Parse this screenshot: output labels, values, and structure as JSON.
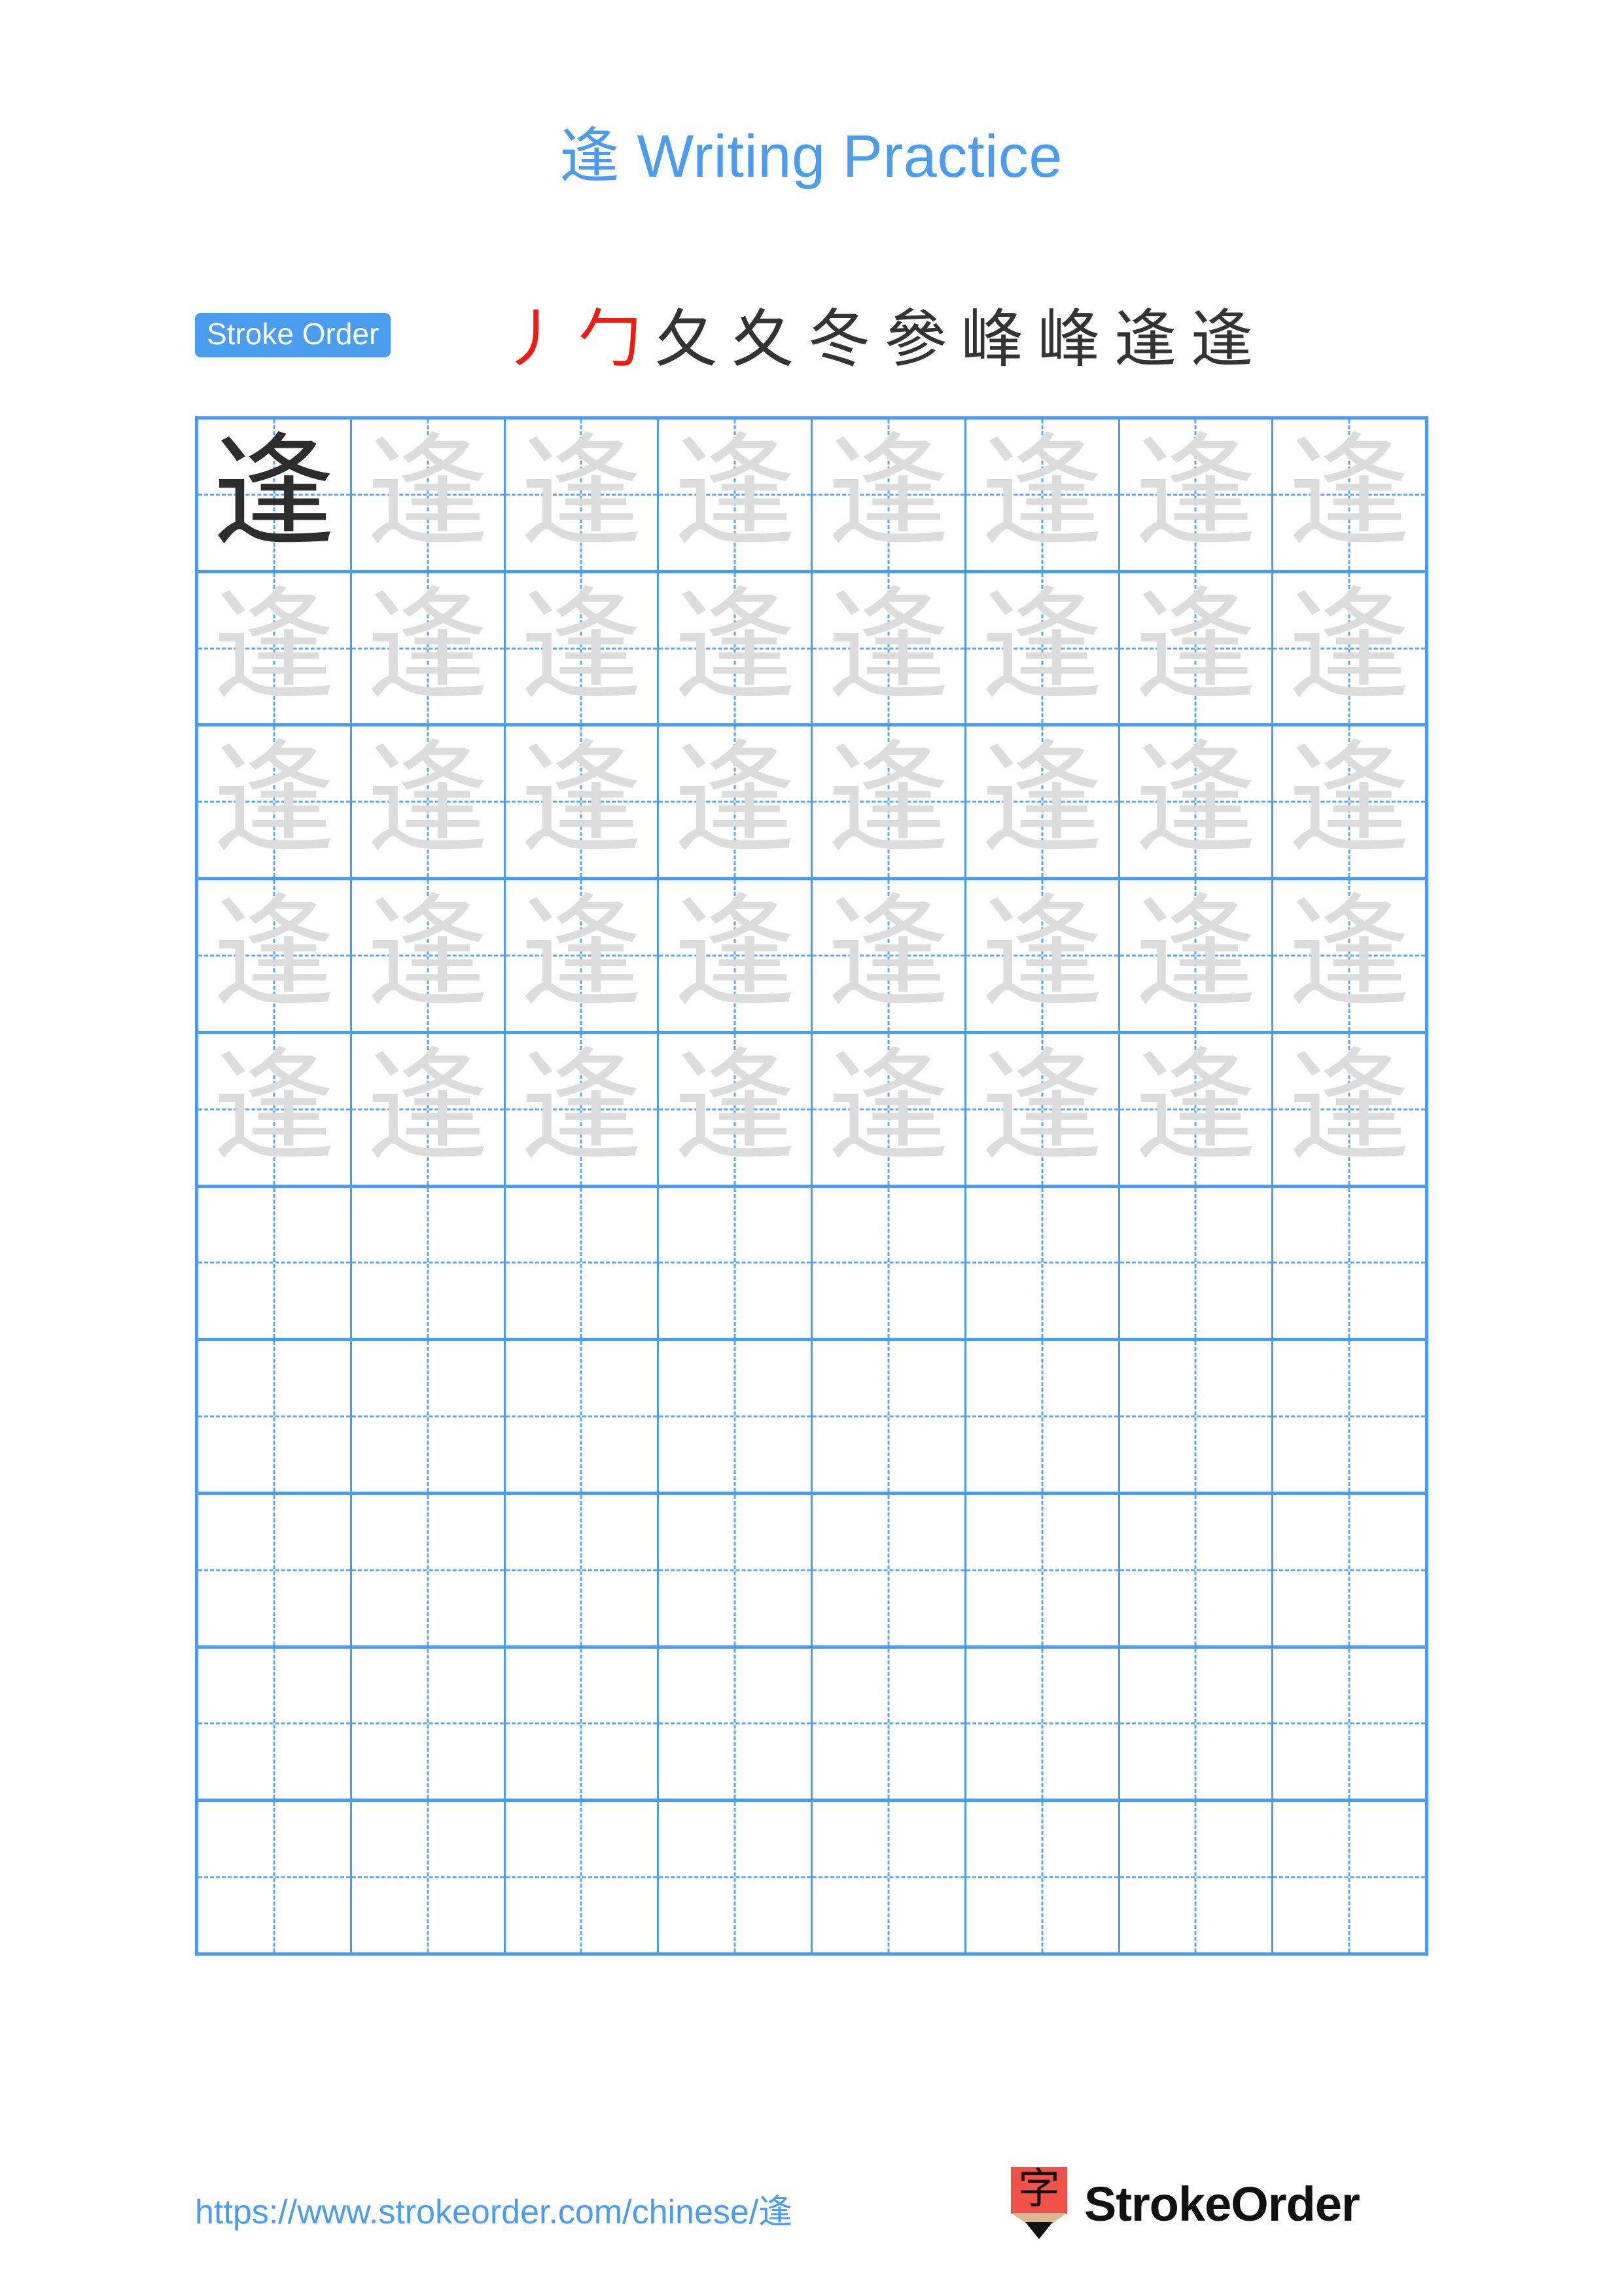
{
  "character": "逢",
  "header": {
    "title": "逢 Writing Practice"
  },
  "stroke_order": {
    "badge_label": "Stroke Order",
    "total_strokes": 10,
    "steps": [
      {
        "index": 1,
        "glyph": "丿",
        "new_stroke_color": "#ee1b11",
        "all_new": true
      },
      {
        "index": 2,
        "glyph": "勹",
        "new_stroke_color": "#ee1b11",
        "all_new": true
      },
      {
        "index": 3,
        "glyph": "夂",
        "new_stroke_color": "#ee1b11",
        "all_new": false
      },
      {
        "index": 4,
        "glyph": "夊",
        "new_stroke_color": "#ee1b11",
        "all_new": false
      },
      {
        "index": 5,
        "glyph": "冬",
        "new_stroke_color": "#ee1b11",
        "all_new": false
      },
      {
        "index": 6,
        "glyph": "參",
        "new_stroke_color": "#ee1b11",
        "all_new": false
      },
      {
        "index": 7,
        "glyph": "峰",
        "new_stroke_color": "#ee1b11",
        "all_new": false
      },
      {
        "index": 8,
        "glyph": "峰",
        "new_stroke_color": "#ee1b11",
        "all_new": false
      },
      {
        "index": 9,
        "glyph": "逢",
        "new_stroke_color": "#ee1b11",
        "all_new": false
      },
      {
        "index": 10,
        "glyph": "逢",
        "new_stroke_color": "#ee1b11",
        "all_new": false
      }
    ]
  },
  "grid": {
    "columns": 8,
    "rows": 10,
    "filled_rows": 5,
    "first_cell_style": "dark",
    "trace_style": "light",
    "border_color": "#4a9cf0",
    "guide_color": "#5aa8f2",
    "dark_char_color": "#2d2d2d",
    "light_char_color": "#dcdcdc",
    "cells": [
      [
        "逢",
        "逢",
        "逢",
        "逢",
        "逢",
        "逢",
        "逢",
        "逢"
      ],
      [
        "逢",
        "逢",
        "逢",
        "逢",
        "逢",
        "逢",
        "逢",
        "逢"
      ],
      [
        "逢",
        "逢",
        "逢",
        "逢",
        "逢",
        "逢",
        "逢",
        "逢"
      ],
      [
        "逢",
        "逢",
        "逢",
        "逢",
        "逢",
        "逢",
        "逢",
        "逢"
      ],
      [
        "逢",
        "逢",
        "逢",
        "逢",
        "逢",
        "逢",
        "逢",
        "逢"
      ],
      [
        "",
        "",
        "",
        "",
        "",
        "",
        "",
        ""
      ],
      [
        "",
        "",
        "",
        "",
        "",
        "",
        "",
        ""
      ],
      [
        "",
        "",
        "",
        "",
        "",
        "",
        "",
        ""
      ],
      [
        "",
        "",
        "",
        "",
        "",
        "",
        "",
        ""
      ],
      [
        "",
        "",
        "",
        "",
        "",
        "",
        "",
        ""
      ]
    ]
  },
  "footer": {
    "url": "https://www.strokeorder.com/chinese/逢",
    "brand_name": "StrokeOrder",
    "logo_char": "字",
    "logo_body_color": "#f0524a",
    "logo_wood_color": "#d9b894"
  },
  "theme": {
    "accent_blue": "#4a9cf0",
    "stroke_red": "#ee1b11",
    "background": "#ffffff"
  }
}
